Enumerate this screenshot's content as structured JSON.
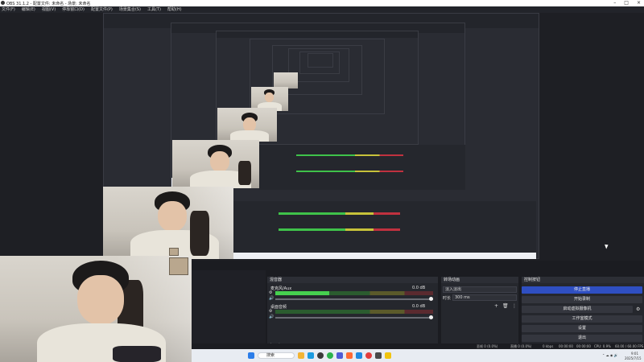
{
  "window": {
    "title": "OBS 31.1.2 - 配置文件: 未命名 - 场景: 未命名"
  },
  "menu": [
    "文件(F)",
    "编辑(E)",
    "视图(V)",
    "停靠窗口(D)",
    "配置文件(P)",
    "场景集合(S)",
    "工具(T)",
    "帮助(H)"
  ],
  "dock": {
    "sources_title": "混音器",
    "mixer": [
      {
        "name": "麦克风/Aux",
        "level_db": "0.0 dB",
        "fill": 0.34
      },
      {
        "name": "桌面音频",
        "level_db": "0.0 dB",
        "fill": 0.0
      }
    ],
    "transition_title": "转场动画",
    "transition_value": "淡入淡出",
    "duration_label": "时长",
    "duration_value": "300 ms",
    "controls_title": "控制按钮",
    "controls": {
      "stop_recording": "停止直播",
      "start_recording": "开始录制",
      "virtual_cam": "启动虚拟摄像机",
      "studio_mode": "工作室模式",
      "settings": "设置",
      "exit": "退出"
    }
  },
  "status": {
    "dropped": "丢帧 0 (0.0%)",
    "live": "直播 0 (0.0%)",
    "bitrate": "0 kbps",
    "time": "00:00:00",
    "rec_time": "00:00:00",
    "cpu": "CPU: 0.9%",
    "fps": "60.00 / 60.00 FPS"
  },
  "taskbar": {
    "search_placeholder": "搜索",
    "clock_time": "9:01",
    "clock_date": "2025/7/15"
  },
  "colors": {
    "accent": "#2f4fc2",
    "meter_green": "#46d04f",
    "meter_yellow": "#c7c23a",
    "meter_red": "#c0313f"
  }
}
